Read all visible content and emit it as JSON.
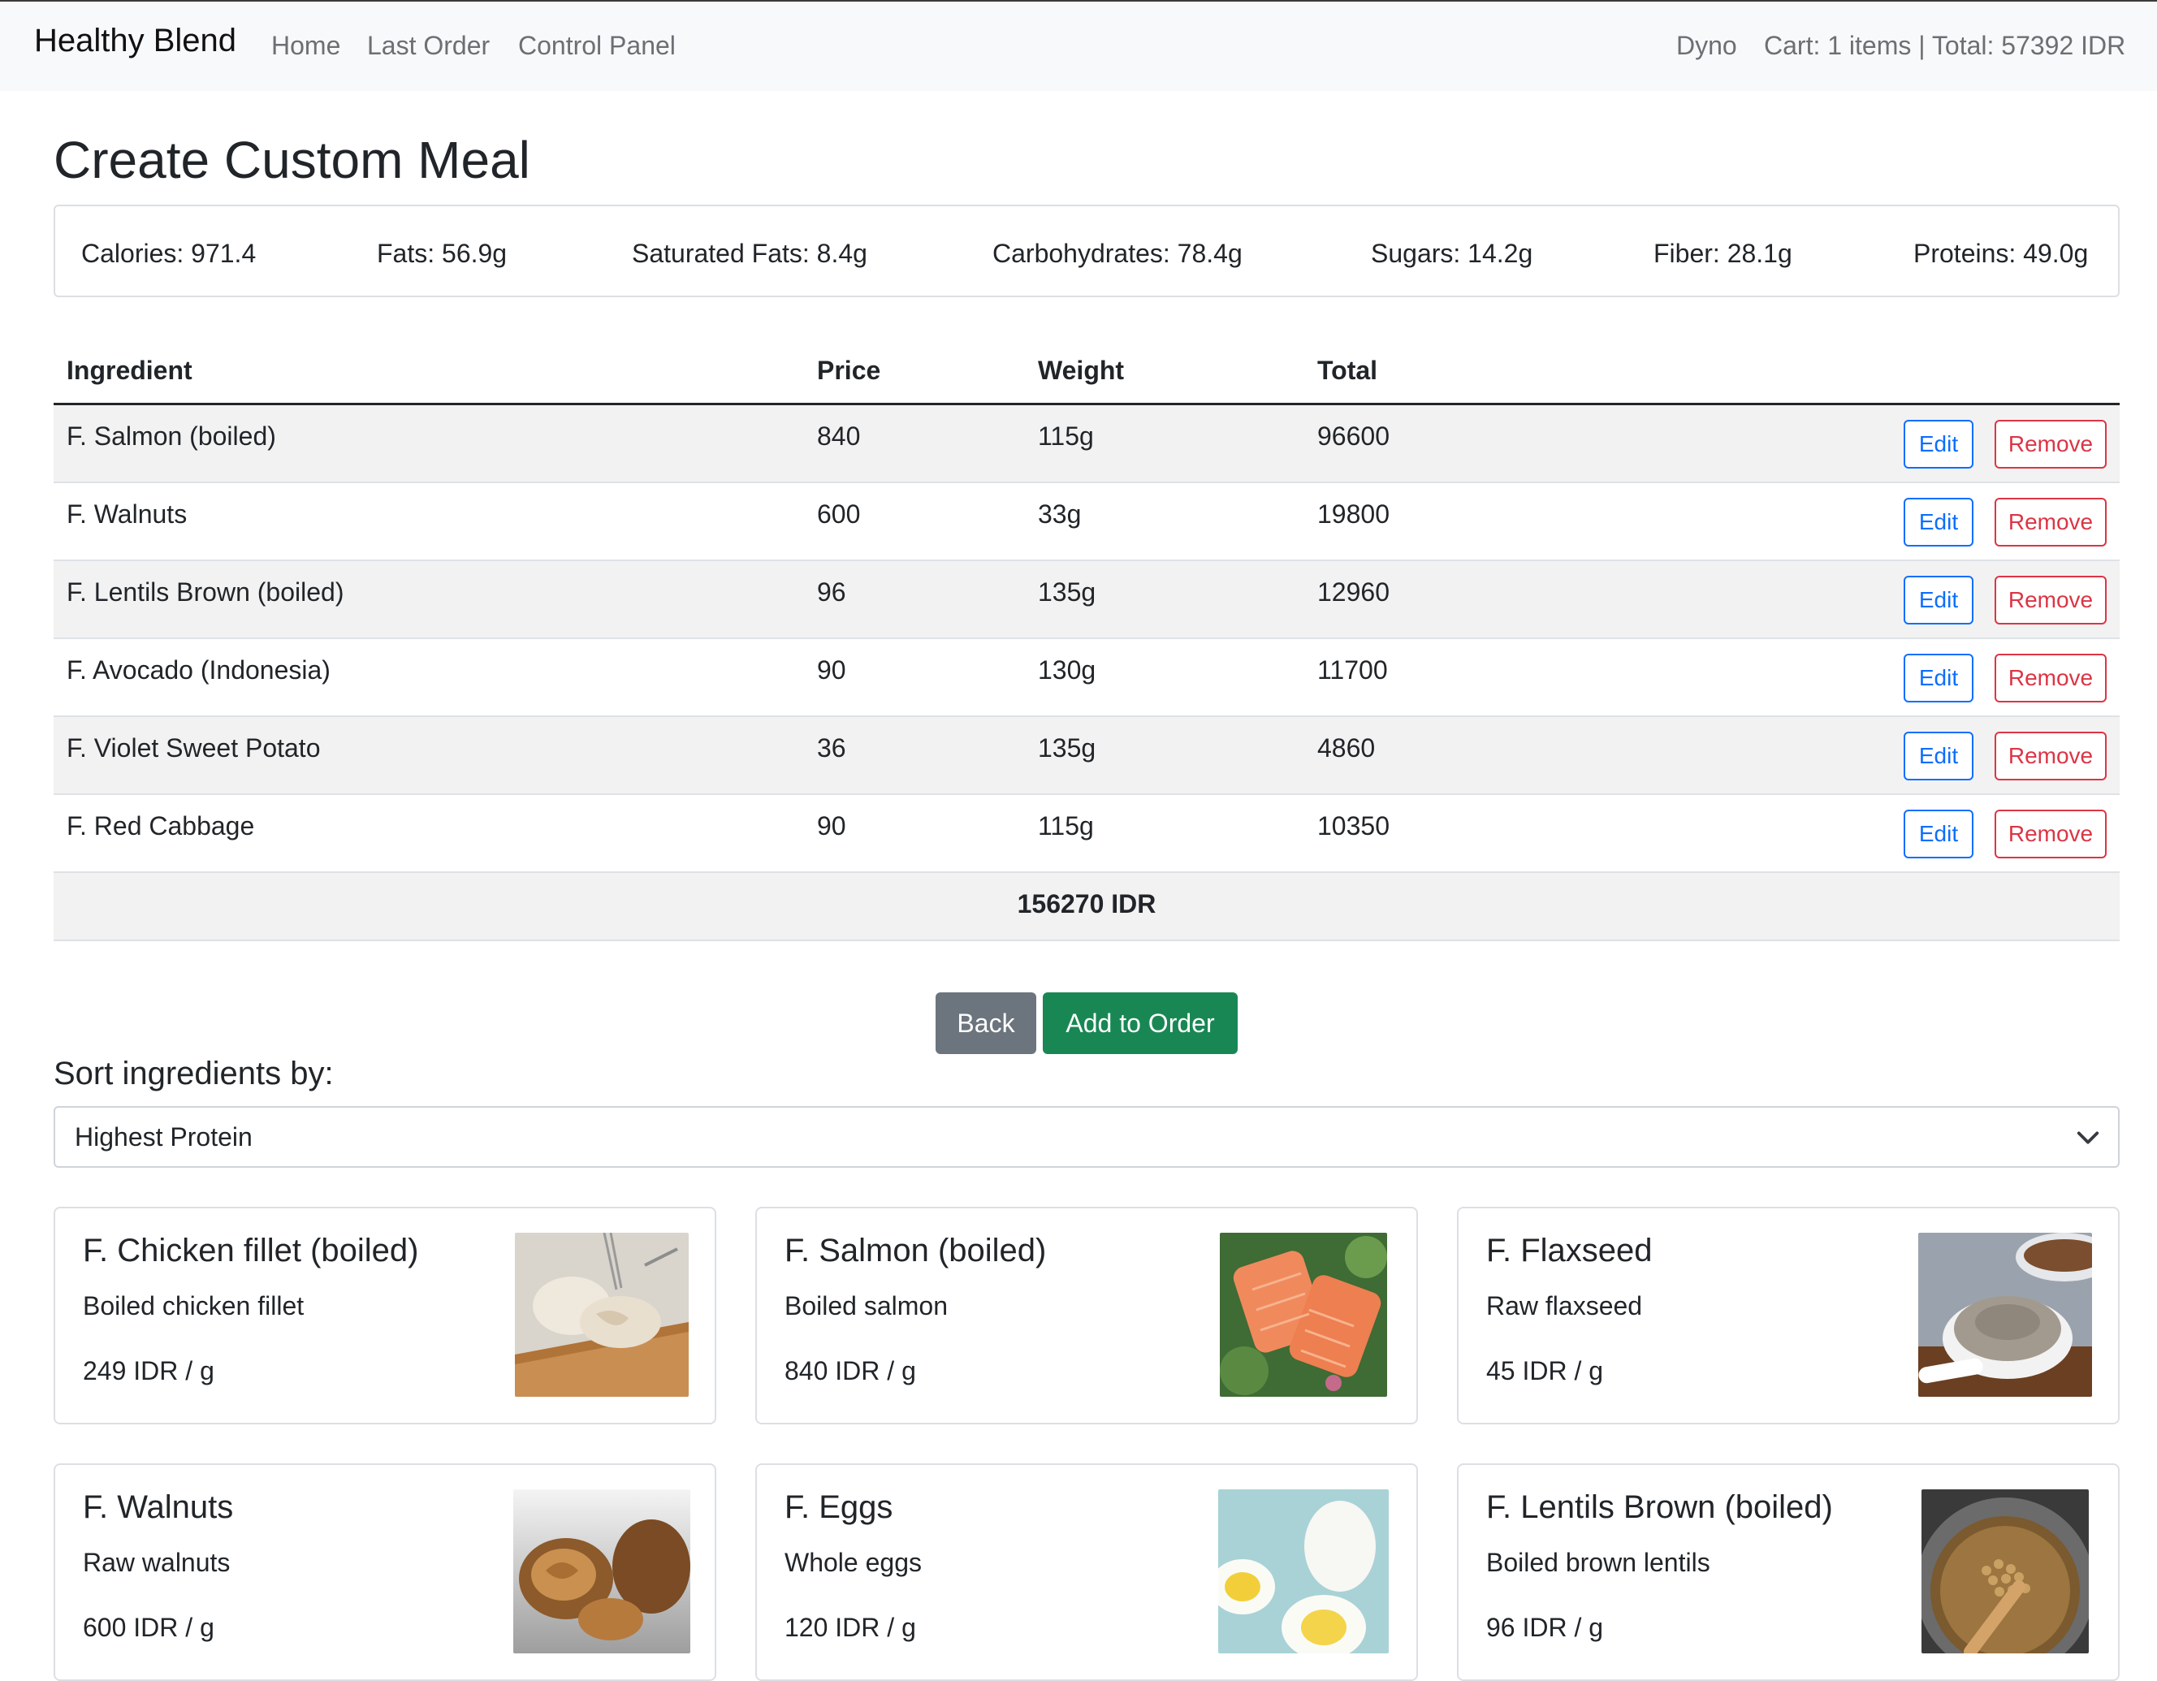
{
  "navbar": {
    "brand": "Healthy Blend",
    "links": [
      "Home",
      "Last Order",
      "Control Panel"
    ],
    "user": "Dyno",
    "cart": "Cart: 1 items | Total: 57392 IDR"
  },
  "page_title": "Create Custom Meal",
  "nutrition": [
    "Calories: 971.4",
    "Fats: 56.9g",
    "Saturated Fats: 8.4g",
    "Carbohydrates: 78.4g",
    "Sugars: 14.2g",
    "Fiber: 28.1g",
    "Proteins: 49.0g"
  ],
  "table": {
    "headers": [
      "Ingredient",
      "Price",
      "Weight",
      "Total"
    ],
    "edit_label": "Edit",
    "remove_label": "Remove",
    "rows": [
      {
        "ingredient": "F. Salmon (boiled)",
        "price": "840",
        "weight": "115g",
        "total": "96600"
      },
      {
        "ingredient": "F. Walnuts",
        "price": "600",
        "weight": "33g",
        "total": "19800"
      },
      {
        "ingredient": "F. Lentils Brown (boiled)",
        "price": "96",
        "weight": "135g",
        "total": "12960"
      },
      {
        "ingredient": "F. Avocado (Indonesia)",
        "price": "90",
        "weight": "130g",
        "total": "11700"
      },
      {
        "ingredient": "F. Violet Sweet Potato",
        "price": "36",
        "weight": "135g",
        "total": "4860"
      },
      {
        "ingredient": "F. Red Cabbage",
        "price": "90",
        "weight": "115g",
        "total": "10350"
      }
    ],
    "grand_total": "156270 IDR"
  },
  "actions": {
    "back": "Back",
    "add_to_order": "Add to Order"
  },
  "sort": {
    "label": "Sort ingredients by:",
    "selected": "Highest Protein"
  },
  "cards": [
    {
      "title": "F. Chicken fillet (boiled)",
      "desc": "Boiled chicken fillet",
      "price": "249 IDR / g",
      "image": "chicken-fillet-photo"
    },
    {
      "title": "F. Salmon (boiled)",
      "desc": "Boiled salmon",
      "price": "840 IDR / g",
      "image": "salmon-photo"
    },
    {
      "title": "F. Flaxseed",
      "desc": "Raw flaxseed",
      "price": "45 IDR / g",
      "image": "flaxseed-photo"
    },
    {
      "title": "F. Walnuts",
      "desc": "Raw walnuts",
      "price": "600 IDR / g",
      "image": "walnuts-photo"
    },
    {
      "title": "F. Eggs",
      "desc": "Whole eggs",
      "price": "120 IDR / g",
      "image": "eggs-photo"
    },
    {
      "title": "F. Lentils Brown (boiled)",
      "desc": "Boiled brown lentils",
      "price": "96 IDR / g",
      "image": "lentils-photo"
    }
  ],
  "colors": {
    "primary": "#0d6efd",
    "danger": "#dc3545",
    "success": "#198754",
    "secondary": "#6c757d",
    "navbar_bg": "#f8f9fa"
  }
}
